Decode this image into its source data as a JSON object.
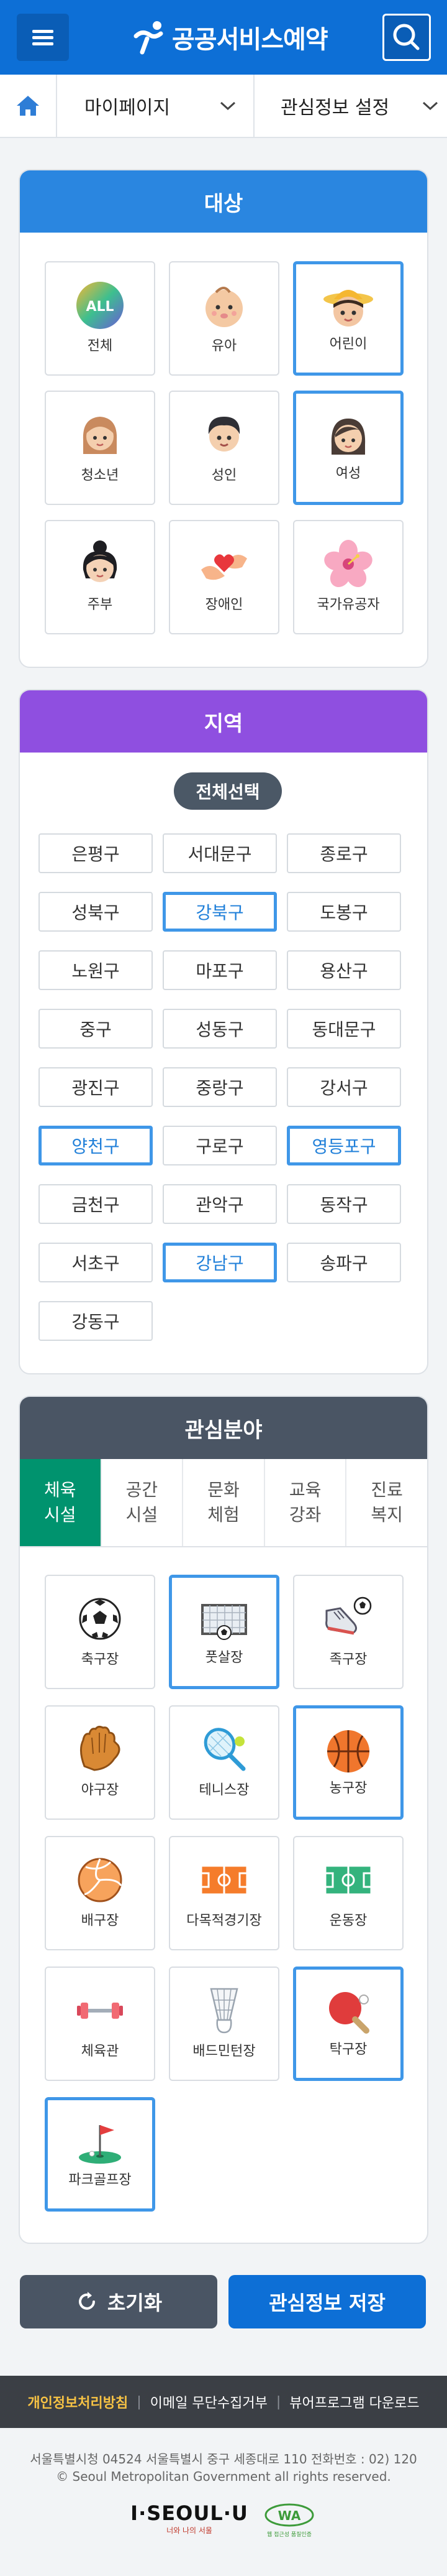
{
  "header": {
    "title": "공공서비스예약",
    "menu_icon": "hamburger-menu-icon",
    "search_icon": "search-icon",
    "brand_color": "#0d6fd6"
  },
  "breadcrumb": {
    "home_icon": "home-icon",
    "level1": "마이페이지",
    "level2": "관심정보 설정"
  },
  "target": {
    "title": "대상",
    "color": "#2a86e0",
    "items": [
      {
        "label": "전체",
        "icon": "all-icon",
        "selected": false
      },
      {
        "label": "유아",
        "icon": "baby-icon",
        "selected": false
      },
      {
        "label": "어린이",
        "icon": "child-icon",
        "selected": true
      },
      {
        "label": "청소년",
        "icon": "teen-icon",
        "selected": false
      },
      {
        "label": "성인",
        "icon": "adult-icon",
        "selected": false
      },
      {
        "label": "여성",
        "icon": "woman-icon",
        "selected": true
      },
      {
        "label": "주부",
        "icon": "housewife-icon",
        "selected": false
      },
      {
        "label": "장애인",
        "icon": "disabled-heart-icon",
        "selected": false
      },
      {
        "label": "국가유공자",
        "icon": "hibiscus-icon",
        "selected": false
      }
    ]
  },
  "region": {
    "title": "지역",
    "color": "#8f4fe0",
    "select_all": "전체선택",
    "items": [
      {
        "label": "은평구",
        "selected": false
      },
      {
        "label": "서대문구",
        "selected": false
      },
      {
        "label": "종로구",
        "selected": false
      },
      {
        "label": "성북구",
        "selected": false
      },
      {
        "label": "강북구",
        "selected": true
      },
      {
        "label": "도봉구",
        "selected": false
      },
      {
        "label": "노원구",
        "selected": false
      },
      {
        "label": "마포구",
        "selected": false
      },
      {
        "label": "용산구",
        "selected": false
      },
      {
        "label": "중구",
        "selected": false
      },
      {
        "label": "성동구",
        "selected": false
      },
      {
        "label": "동대문구",
        "selected": false
      },
      {
        "label": "광진구",
        "selected": false
      },
      {
        "label": "중랑구",
        "selected": false
      },
      {
        "label": "강서구",
        "selected": false
      },
      {
        "label": "양천구",
        "selected": true
      },
      {
        "label": "구로구",
        "selected": false
      },
      {
        "label": "영등포구",
        "selected": true
      },
      {
        "label": "금천구",
        "selected": false
      },
      {
        "label": "관악구",
        "selected": false
      },
      {
        "label": "동작구",
        "selected": false
      },
      {
        "label": "서초구",
        "selected": false
      },
      {
        "label": "강남구",
        "selected": true
      },
      {
        "label": "송파구",
        "selected": false
      },
      {
        "label": "강동구",
        "selected": false
      }
    ]
  },
  "interest": {
    "title": "관심분야",
    "color": "#4a5564",
    "tabs": [
      {
        "label": "체육\n시설",
        "active": true
      },
      {
        "label": "공간\n시설",
        "active": false
      },
      {
        "label": "문화\n체험",
        "active": false
      },
      {
        "label": "교육\n강좌",
        "active": false
      },
      {
        "label": "진료\n복지",
        "active": false
      }
    ],
    "items": [
      {
        "label": "축구장",
        "icon": "soccer-ball-icon",
        "selected": false
      },
      {
        "label": "풋살장",
        "icon": "futsal-goal-icon",
        "selected": true
      },
      {
        "label": "족구장",
        "icon": "jokgu-shoe-icon",
        "selected": false
      },
      {
        "label": "야구장",
        "icon": "baseball-glove-icon",
        "selected": false
      },
      {
        "label": "테니스장",
        "icon": "tennis-racket-icon",
        "selected": false
      },
      {
        "label": "농구장",
        "icon": "basketball-icon",
        "selected": true
      },
      {
        "label": "배구장",
        "icon": "volleyball-icon",
        "selected": false
      },
      {
        "label": "다목적경기장",
        "icon": "multi-court-icon",
        "selected": false
      },
      {
        "label": "운동장",
        "icon": "field-icon",
        "selected": false
      },
      {
        "label": "체육관",
        "icon": "dumbbell-icon",
        "selected": false
      },
      {
        "label": "배드민턴장",
        "icon": "shuttlecock-icon",
        "selected": false
      },
      {
        "label": "탁구장",
        "icon": "ping-pong-icon",
        "selected": true
      },
      {
        "label": "파크골프장",
        "icon": "golf-flag-icon",
        "selected": true
      }
    ]
  },
  "actions": {
    "reset": "초기화",
    "save": "관심정보 저장",
    "reset_color": "#4a5564",
    "save_color": "#0d6fd6"
  },
  "footer": {
    "privacy": "개인정보처리방침",
    "no_email": "이메일 무단수집거부",
    "viewer": "뷰어프로그램 다운로드",
    "address": "서울특별시청 04524 서울특별시 중구 세종대로 110 전화번호 : 02) 120",
    "copyright": "© Seoul Metropolitan Government all rights reserved.",
    "logo_text": "I·SEOUL·U",
    "logo_sub": "너와 나의 서울",
    "badge_text": "WA",
    "badge_sub": "웹 접근성 품질인증"
  }
}
